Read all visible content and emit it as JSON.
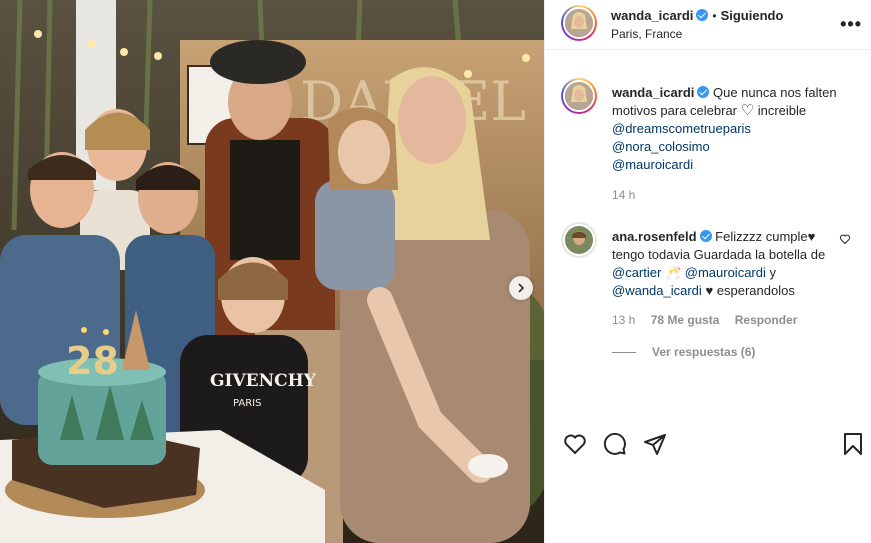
{
  "post": {
    "author": "wanda_icardi",
    "follow_status": "Siguiendo",
    "separator": "•",
    "location": "Paris, France",
    "more_label": "•••"
  },
  "caption": {
    "author": "wanda_icardi",
    "text": "Que nunca nos falten motivos para celebrar",
    "heart": "♡",
    "text_after": "increible",
    "mentions": [
      "@dreamscometrueparis",
      "@nora_colosimo",
      "@mauroicardi"
    ],
    "time": "14 h"
  },
  "comment": {
    "author": "ana.rosenfeld",
    "text_1": "Felizzzz cumple♥ tengo todavia Guardada la botella de",
    "mention_1": "@cartier",
    "emoji": "🥂",
    "mention_2": "@mauroicardi",
    "y": "y",
    "mention_3": "@wanda_icardi",
    "text_2": "♥ esperandolos",
    "time": "13 h",
    "likes": "78 Me gusta",
    "reply": "Responder",
    "view_replies": "Ver respuestas (6)"
  },
  "photo": {
    "cake_number": "28",
    "shirt_brand": "GIVENCHY",
    "shirt_city": "PARIS"
  },
  "colors": {
    "link": "#00376b",
    "verified": "#3897f0",
    "muted": "#8e8e8e"
  },
  "icons": [
    "heart-icon",
    "comment-icon",
    "share-icon",
    "save-icon",
    "verified-icon",
    "more-icon",
    "next-arrow-icon"
  ]
}
